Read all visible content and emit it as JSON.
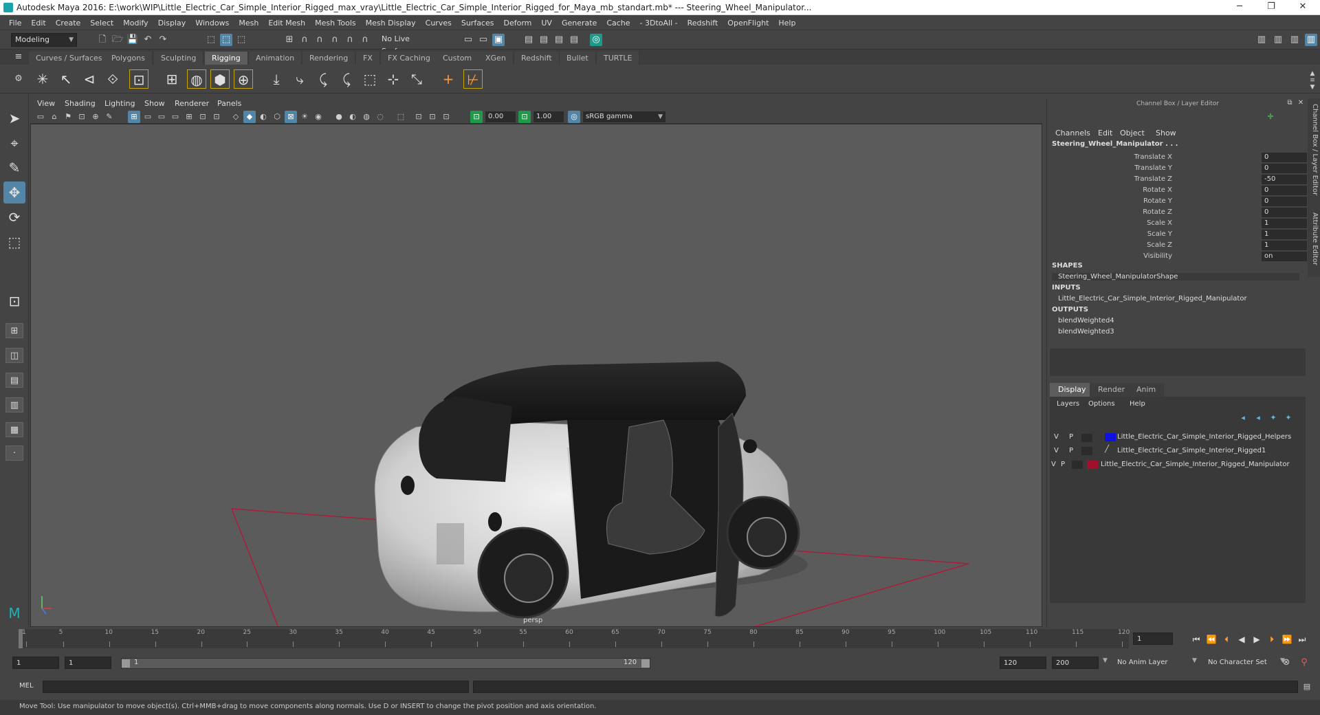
{
  "window": {
    "title": "Autodesk Maya 2016: E:\\work\\WIP\\Little_Electric_Car_Simple_Interior_Rigged_max_vray\\Little_Electric_Car_Simple_Interior_Rigged_for_Maya_mb_standart.mb*   ---   Steering_Wheel_Manipulator...",
    "min": "─",
    "max": "❐",
    "close": "✕"
  },
  "menus": [
    "File",
    "Edit",
    "Create",
    "Select",
    "Modify",
    "Display",
    "Windows",
    "Mesh",
    "Edit Mesh",
    "Mesh Tools",
    "Mesh Display",
    "Curves",
    "Surfaces",
    "Deform",
    "UV",
    "Generate",
    "Cache",
    "- 3DtoAll -",
    "Redshift",
    "OpenFlight",
    "Help"
  ],
  "status": {
    "mode": "Modeling",
    "live_surface": "No Live Surface"
  },
  "shelf_tabs": [
    "Curves / Surfaces",
    "Polygons",
    "Sculpting",
    "Rigging",
    "Animation",
    "Rendering",
    "FX",
    "FX Caching",
    "Custom",
    "XGen",
    "Redshift",
    "Bullet",
    "TURTLE"
  ],
  "active_shelf_tab": "Rigging",
  "viewport": {
    "menu": [
      "View",
      "Shading",
      "Lighting",
      "Show",
      "Renderer",
      "Panels"
    ],
    "exposure": "0.00",
    "gamma": "1.00",
    "color_space": "sRGB gamma",
    "camera_label": "persp"
  },
  "channel_box": {
    "title": "Channel Box / Layer Editor",
    "menu": [
      "Channels",
      "Edit",
      "Object",
      "Show"
    ],
    "object_name": "Steering_Wheel_Manipulator . . .",
    "attributes": [
      {
        "name": "Translate X",
        "value": "0"
      },
      {
        "name": "Translate Y",
        "value": "0"
      },
      {
        "name": "Translate Z",
        "value": "-50"
      },
      {
        "name": "Rotate X",
        "value": "0"
      },
      {
        "name": "Rotate Y",
        "value": "0"
      },
      {
        "name": "Rotate Z",
        "value": "0"
      },
      {
        "name": "Scale X",
        "value": "1"
      },
      {
        "name": "Scale Y",
        "value": "1"
      },
      {
        "name": "Scale Z",
        "value": "1"
      },
      {
        "name": "Visibility",
        "value": "on"
      }
    ],
    "shapes_header": "SHAPES",
    "shape": "Steering_Wheel_ManipulatorShape",
    "inputs_header": "INPUTS",
    "input": "Little_Electric_Car_Simple_Interior_Rigged_Manipulator",
    "outputs_header": "OUTPUTS",
    "outputs": [
      "blendWeighted4",
      "blendWeighted3"
    ]
  },
  "layer_editor": {
    "tabs": [
      "Display",
      "Render",
      "Anim"
    ],
    "active_tab": "Display",
    "menu": [
      "Layers",
      "Options",
      "Help"
    ],
    "layers": [
      {
        "v": "V",
        "p": "P",
        "name": "Little_Electric_Car_Simple_Interior_Rigged_Helpers",
        "color": "#1010e0"
      },
      {
        "v": "V",
        "p": "P",
        "name": "Little_Electric_Car_Simple_Interior_Rigged1",
        "color": ""
      },
      {
        "v": "V",
        "p": "P",
        "name": "Little_Electric_Car_Simple_Interior_Rigged_Manipulator",
        "color": "#a0102a"
      }
    ]
  },
  "side_tabs": [
    "Channel Box / Layer Editor",
    "Attribute Editor"
  ],
  "timeline": {
    "ticks": [
      "1",
      "5",
      "10",
      "15",
      "20",
      "25",
      "30",
      "35",
      "40",
      "45",
      "50",
      "55",
      "60",
      "65",
      "70",
      "75",
      "80",
      "85",
      "90",
      "95",
      "100",
      "105",
      "110",
      "115",
      "120"
    ],
    "current_frame": "1",
    "range_start": "1",
    "range_inner_start": "1",
    "slider_start": "1",
    "slider_end": "120",
    "range_end": "120",
    "anim_end": "200",
    "anim_layer": "No Anim Layer",
    "character_set": "No Character Set"
  },
  "command_line": {
    "label": "MEL"
  },
  "help_line": "Move Tool: Use manipulator to move object(s). Ctrl+MMB+drag to move components along normals. Use D or INSERT to change the pivot position and axis orientation.",
  "colors": {
    "accent": "#5285a6",
    "ground_grid": "#b0193a"
  }
}
